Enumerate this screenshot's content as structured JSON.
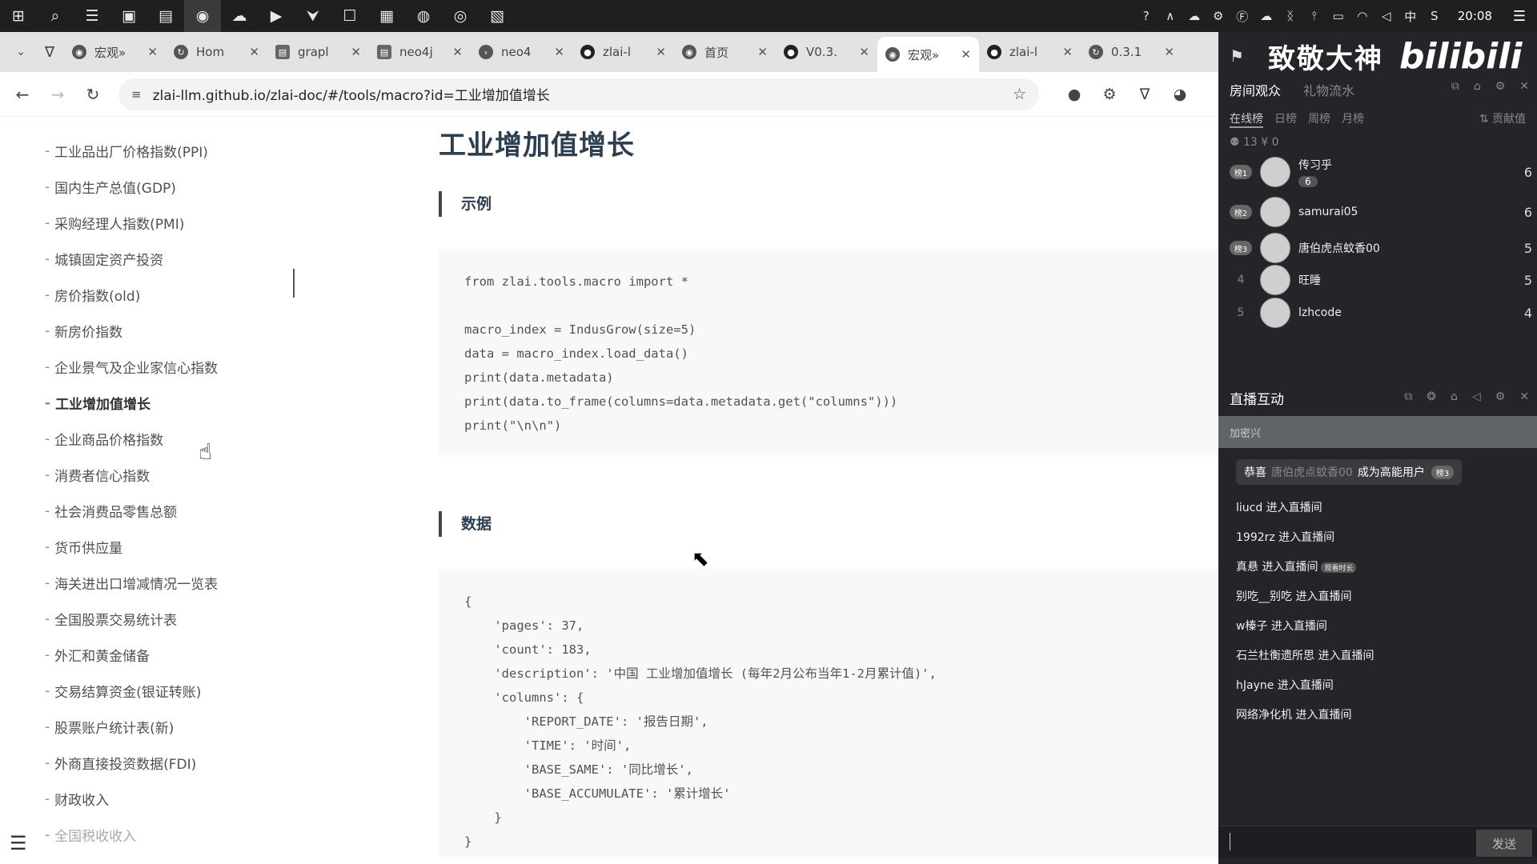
{
  "taskbar": {
    "icons": [
      "windows-icon",
      "search-icon",
      "task-view-icon",
      "app-icon",
      "app-icon",
      "obs-icon",
      "wechat-icon",
      "app-icon",
      "app-icon",
      "app-icon",
      "app-icon",
      "app-icon",
      "app-icon",
      "app-icon"
    ],
    "clock": "20:08",
    "ime": "中"
  },
  "tabs": [
    {
      "title": "宏观»",
      "fav": "chrome"
    },
    {
      "title": "Hom",
      "fav": "loading"
    },
    {
      "title": "grapl",
      "fav": "doc"
    },
    {
      "title": "neo4j",
      "fav": "doc"
    },
    {
      "title": "neo4",
      "fav": "terminal"
    },
    {
      "title": "zlai-l",
      "fav": "github"
    },
    {
      "title": "首页",
      "fav": "chrome"
    },
    {
      "title": "V0.3.",
      "fav": "github"
    },
    {
      "title": "宏观»",
      "fav": "chrome",
      "active": true
    },
    {
      "title": "zlai-l",
      "fav": "github"
    },
    {
      "title": "0.3.1",
      "fav": "loading"
    }
  ],
  "address": {
    "url": "zlai-llm.github.io/zlai-doc/#/tools/macro?id=工业增加值增长"
  },
  "sidebar": {
    "items": [
      "工业品出厂价格指数(PPI)",
      "国内生产总值(GDP)",
      "采购经理人指数(PMI)",
      "城镇固定资产投资",
      "房价指数(old)",
      "新房价指数",
      "企业景气及企业家信心指数",
      "工业增加值增长",
      "企业商品价格指数",
      "消费者信心指数",
      "社会消费品零售总额",
      "货币供应量",
      "海关进出口增减情况一览表",
      "全国股票交易统计表",
      "外汇和黄金储备",
      "交易结算资金(银证转账)",
      "股票账户统计表(新)",
      "外商直接投资数据(FDI)",
      "财政收入",
      "全国税收收入"
    ],
    "active_index": 7
  },
  "main": {
    "title": "工业增加值增长",
    "section1": "示例",
    "code_example": "from zlai.tools.macro import *\n\nmacro_index = IndusGrow(size=5)\ndata = macro_index.load_data()\nprint(data.metadata)\nprint(data.to_frame(columns=data.metadata.get(\"columns\")))\nprint(\"\\n\\n\")",
    "section2": "数据",
    "code_data": "{\n    'pages': 37,\n    'count': 183,\n    'description': '中国 工业增加值增长 (每年2月公布当年1-2月累计值)',\n    'columns': {\n        'REPORT_DATE': '报告日期',\n        'TIME': '时间',\n        'BASE_SAME': '同比增长',\n        'BASE_ACCUMULATE': '累计增长'\n    }\n}"
  },
  "overlay": {
    "brand": "致敬大神",
    "bili_logo": "bilibili",
    "tabs": [
      "房间观众",
      "礼物流水"
    ],
    "rank_tabs": [
      "在线榜",
      "日榜",
      "周榜",
      "月榜"
    ],
    "contrib": "贡献值",
    "stats": "13  ¥ 0",
    "viewers": [
      {
        "rank": "榜1",
        "name": "传习乎",
        "level": "6",
        "score": "6"
      },
      {
        "rank": "榜2",
        "name": "samurai05",
        "score": "6"
      },
      {
        "rank": "榜3",
        "name": "唐伯虎点蚊香00",
        "score": "5"
      },
      {
        "rank": "4",
        "name": "旺睡",
        "score": "5"
      },
      {
        "rank": "5",
        "name": "lzhcode",
        "score": "4"
      }
    ],
    "interact_title": "直播互动",
    "banner": "加密兴",
    "congrats": {
      "prefix": "恭喜",
      "user": "唐伯虎点蚊香00",
      "suffix": "成为高能用户",
      "badge": "榜3"
    },
    "messages": [
      {
        "text": "liucd 进入直播间"
      },
      {
        "text": "1992rz 进入直播间"
      },
      {
        "text": "真悬 进入直播间",
        "tag": "观看时长"
      },
      {
        "text": "别吃__别吃 进入直播间"
      },
      {
        "text": "w榛子 进入直播间"
      },
      {
        "text": "石兰杜衡遗所思 进入直播间"
      },
      {
        "text": "hJayne 进入直播间"
      },
      {
        "text": "网络净化机 进入直播间"
      }
    ],
    "send": "发送"
  }
}
